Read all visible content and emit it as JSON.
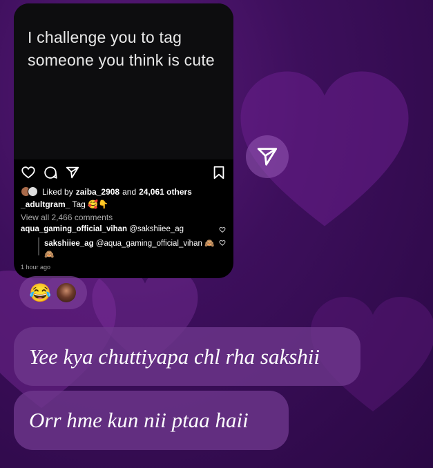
{
  "post": {
    "text": "I challenge you to tag someone you think is cute",
    "liked_prefix": "Liked by",
    "liked_user": "zaiba_2908",
    "liked_and": "and",
    "liked_count": "24,061 others",
    "caption_user": "_adultgram_",
    "caption_text": "Tag 🥰👇",
    "view_comments": "View all 2,466 comments",
    "comment1_user": "aqua_gaming_official_vihan",
    "comment1_text": "@sakshiiee_ag",
    "comment2_user": "sakshiiee_ag",
    "comment2_text": "@aqua_gaming_official_vihan 🙈",
    "comment2_cont": "🙈",
    "timestamp": "1 hour ago"
  },
  "reaction": {
    "emoji": "😂"
  },
  "messages": [
    {
      "text": "Yee kya chuttiyapa chl rha sakshii"
    },
    {
      "text": "Orr hme kun nii ptaa haii"
    }
  ],
  "icons": [
    "heart-icon",
    "comment-icon",
    "send-icon",
    "bookmark-icon",
    "share-icon"
  ],
  "colors": {
    "background": "#3d0f5c",
    "bubble": "#6e378c",
    "card": "#000000"
  }
}
